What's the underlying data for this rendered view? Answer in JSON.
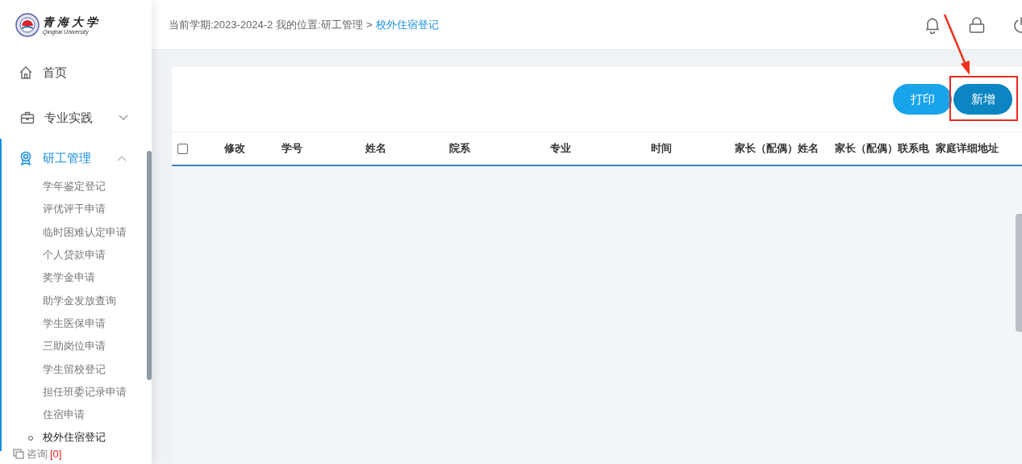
{
  "logo": {
    "name": "青海大学",
    "subtitle": "Qinghai University"
  },
  "sidebar": {
    "items": [
      {
        "label": "首页",
        "kind": "link"
      },
      {
        "label": "专业实践",
        "kind": "group",
        "expanded": false
      },
      {
        "label": "研工管理",
        "kind": "group",
        "expanded": true,
        "children": [
          {
            "label": "学年鉴定登记",
            "selected": false
          },
          {
            "label": "评优评干申请",
            "selected": false
          },
          {
            "label": "临时困难认定申请",
            "selected": false
          },
          {
            "label": "个人贷款申请",
            "selected": false
          },
          {
            "label": "奖学金申请",
            "selected": false
          },
          {
            "label": "助学金发放查询",
            "selected": false
          },
          {
            "label": "学生医保申请",
            "selected": false
          },
          {
            "label": "三助岗位申请",
            "selected": false
          },
          {
            "label": "学生留校登记",
            "selected": false
          },
          {
            "label": "担任班委记录申请",
            "selected": false
          },
          {
            "label": "住宿申请",
            "selected": false
          },
          {
            "label": "校外住宿登记",
            "selected": true
          }
        ]
      }
    ],
    "consult": {
      "label": "咨询",
      "count": "[0]"
    }
  },
  "breadcrumb": {
    "term": "当前学期:2023-2024-2",
    "location": "我的位置:研工管理",
    "separator": ">",
    "current": "校外住宿登记"
  },
  "toolbar": {
    "buttons": [
      {
        "label": "打印",
        "kind": "print",
        "highlighted": false
      },
      {
        "label": "新增",
        "kind": "add",
        "highlighted": true
      }
    ]
  },
  "table": {
    "select_all": {
      "checked": false
    },
    "columns": [
      "修改",
      "学号",
      "姓名",
      "院系",
      "专业",
      "时间",
      "家长（配偶）姓名",
      "家长（配偶）联系电",
      "家庭详细地址"
    ]
  }
}
